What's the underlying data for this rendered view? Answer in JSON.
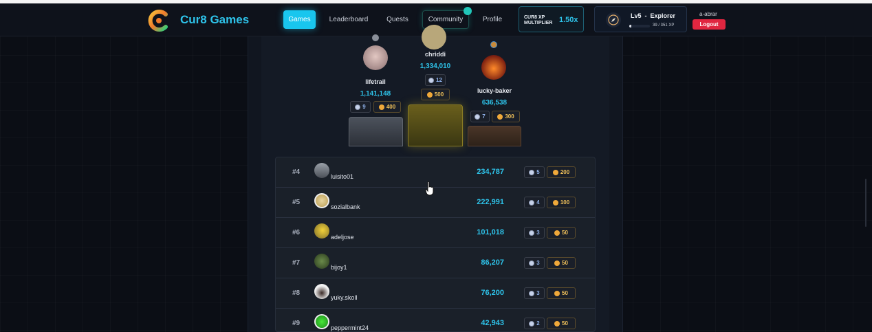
{
  "header": {
    "brand": "Cur8 Games",
    "nav": [
      {
        "label": "Games",
        "active": true
      },
      {
        "label": "Leaderboard",
        "active": false
      },
      {
        "label": "Quests",
        "active": false
      },
      {
        "label": "Community",
        "active": false
      },
      {
        "label": "Profile",
        "active": false
      }
    ],
    "xp_multiplier": {
      "label": "CUR8 XP MULTIPLIER",
      "value": "1.50x"
    },
    "level": {
      "title": "Lv5  -  Explorer",
      "xp_text": "39 / 351 XP",
      "progress": 0.11
    },
    "user": {
      "name": "a-abrar",
      "logout_label": "Logout"
    }
  },
  "podium": [
    {
      "place": 2,
      "name": "lifetrail",
      "score": "1,141,148",
      "games": "9",
      "coins": "400"
    },
    {
      "place": 1,
      "name": "chriddi",
      "score": "1,334,010",
      "games": "12",
      "coins": "500"
    },
    {
      "place": 3,
      "name": "lucky-baker",
      "score": "636,538",
      "games": "7",
      "coins": "300"
    }
  ],
  "rows": [
    {
      "rank": "#4",
      "name": "luisito01",
      "score": "234,787",
      "games": "5",
      "coins": "200"
    },
    {
      "rank": "#5",
      "name": "sozialbank",
      "score": "222,991",
      "games": "4",
      "coins": "100"
    },
    {
      "rank": "#6",
      "name": "adeljose",
      "score": "101,018",
      "games": "3",
      "coins": "50"
    },
    {
      "rank": "#7",
      "name": "bijoy1",
      "score": "86,207",
      "games": "3",
      "coins": "50"
    },
    {
      "rank": "#8",
      "name": "yuky.skoll",
      "score": "76,200",
      "games": "3",
      "coins": "50"
    },
    {
      "rank": "#9",
      "name": "peppermint24",
      "score": "42,943",
      "games": "2",
      "coins": "50"
    }
  ],
  "colors": {
    "accent": "#19c6ee",
    "logout": "#e02640",
    "coin": "#f0a93a"
  }
}
